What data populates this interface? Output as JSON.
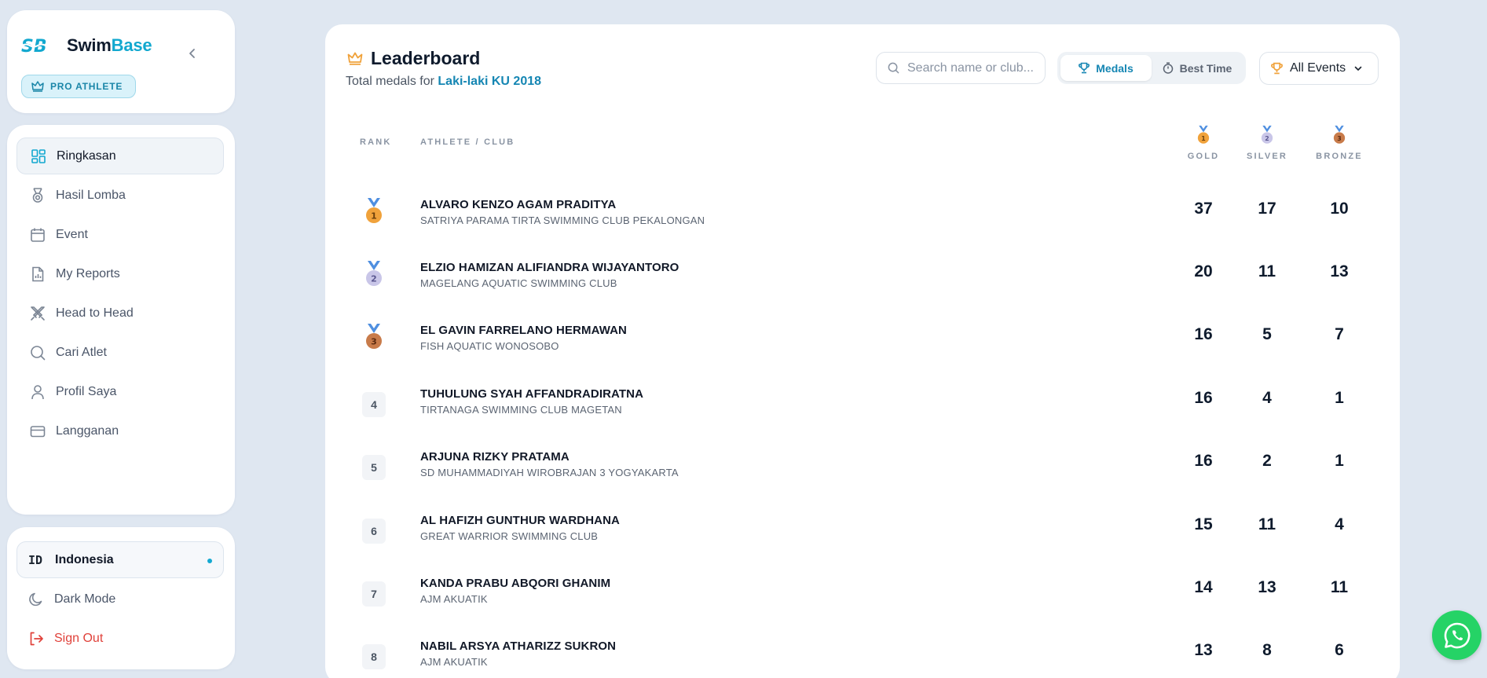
{
  "brand": {
    "logo_text": "SB",
    "name_part1": "Swim",
    "name_part2": "Base",
    "badge": "PRO ATHLETE"
  },
  "sidebar": {
    "items": [
      {
        "label": "Ringkasan",
        "icon": "dashboard-icon",
        "active": true
      },
      {
        "label": "Hasil Lomba",
        "icon": "medal-icon",
        "active": false
      },
      {
        "label": "Event",
        "icon": "calendar-icon",
        "active": false
      },
      {
        "label": "My Reports",
        "icon": "report-icon",
        "active": false
      },
      {
        "label": "Head to Head",
        "icon": "swords-icon",
        "active": false
      },
      {
        "label": "Cari Atlet",
        "icon": "search-icon",
        "active": false
      },
      {
        "label": "Profil Saya",
        "icon": "user-icon",
        "active": false
      },
      {
        "label": "Langganan",
        "icon": "credit-card-icon",
        "active": false
      }
    ],
    "bottom": {
      "language_code": "ID",
      "language": "Indonesia",
      "dark_mode": "Dark Mode",
      "sign_out": "Sign Out"
    }
  },
  "leaderboard": {
    "title": "Leaderboard",
    "subtitle_prefix": "Total medals for",
    "subtitle_highlight": "Laki-laki KU 2018",
    "search_placeholder": "Search name or club...",
    "toggle": {
      "medals": "Medals",
      "best_time": "Best Time",
      "active": "medals"
    },
    "events_select": "All Events",
    "headers": {
      "rank": "RANK",
      "athlete": "ATHLETE / CLUB",
      "gold": "GOLD",
      "silver": "SILVER",
      "bronze": "BRONZE"
    },
    "rows": [
      {
        "rank": "1",
        "name": "ALVARO KENZO AGAM PRADITYA",
        "club": "SATRIYA PARAMA TIRTA SWIMMING CLUB PEKALONGAN",
        "gold": "37",
        "silver": "17",
        "bronze": "10"
      },
      {
        "rank": "2",
        "name": "ELZIO HAMIZAN ALIFIANDRA WIJAYANTORO",
        "club": "MAGELANG AQUATIC SWIMMING CLUB",
        "gold": "20",
        "silver": "11",
        "bronze": "13"
      },
      {
        "rank": "3",
        "name": "EL GAVIN FARRELANO HERMAWAN",
        "club": "FISH AQUATIC WONOSOBO",
        "gold": "16",
        "silver": "5",
        "bronze": "7"
      },
      {
        "rank": "4",
        "name": "TUHULUNG SYAH AFFANDRADIRATNA",
        "club": "TIRTANAGA SWIMMING CLUB MAGETAN",
        "gold": "16",
        "silver": "4",
        "bronze": "1"
      },
      {
        "rank": "5",
        "name": "ARJUNA RIZKY PRATAMA",
        "club": "SD MUHAMMADIYAH WIROBRAJAN 3 YOGYAKARTA",
        "gold": "16",
        "silver": "2",
        "bronze": "1"
      },
      {
        "rank": "6",
        "name": "AL HAFIZH GUNTHUR WARDHANA",
        "club": "GREAT WARRIOR SWIMMING CLUB",
        "gold": "15",
        "silver": "11",
        "bronze": "4"
      },
      {
        "rank": "7",
        "name": "KANDA PRABU ABQORI GHANIM",
        "club": "AJM AKUATIK",
        "gold": "14",
        "silver": "13",
        "bronze": "11"
      },
      {
        "rank": "8",
        "name": "NABIL ARSYA ATHARIZZ SUKRON",
        "club": "AJM AKUATIK",
        "gold": "13",
        "silver": "8",
        "bronze": "6"
      }
    ]
  },
  "colors": {
    "accent": "#12a8cf",
    "gold": "#f0a23b",
    "silver": "#c9c6e8",
    "bronze": "#c87b4a",
    "ribbon": "#4f8fe0",
    "whatsapp": "#25d366",
    "signout": "#e0413a"
  }
}
